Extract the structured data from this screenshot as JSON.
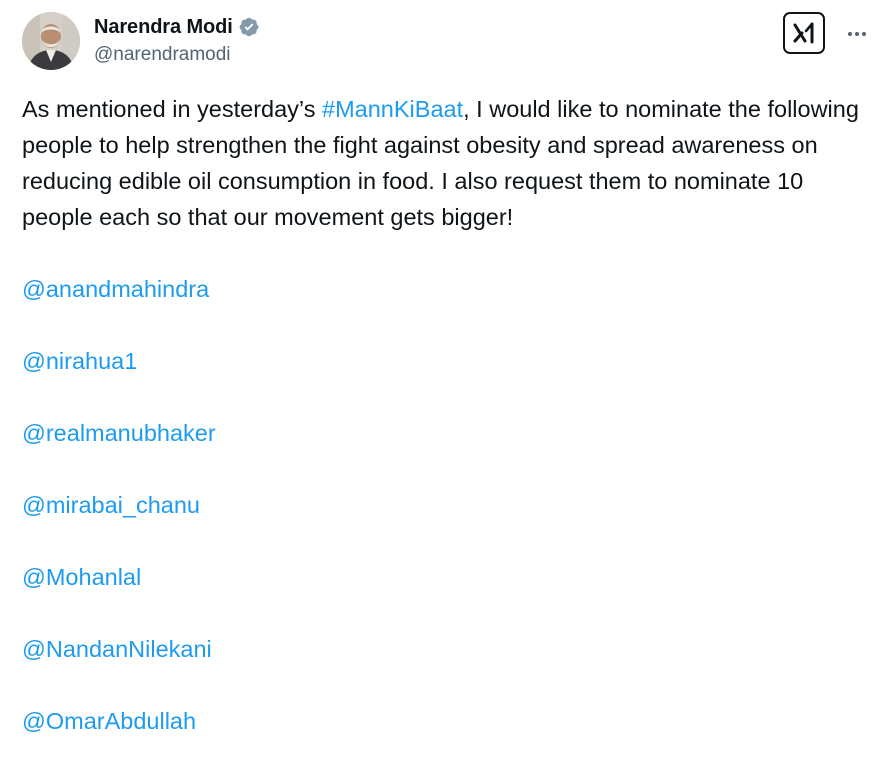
{
  "author": {
    "display_name": "Narendra Modi",
    "handle": "@narendramodi",
    "verified_badge": "verified-checkmark-icon",
    "verified_color": "#829aab"
  },
  "actions": {
    "grok_icon": "grok-logo-icon",
    "more_icon": "more-options-icon"
  },
  "post": {
    "text_before": "As mentioned in yesterday’s ",
    "hashtag": "#MannKiBaat",
    "text_after": ", I would like to nominate the following people to help strengthen the fight against obesity and spread awareness on reducing edible oil consumption in food. I also request them to nominate 10 people each so that our movement gets bigger!",
    "mentions": [
      "@anandmahindra",
      "@nirahua1",
      "@realmanubhaker",
      "@mirabai_chanu",
      "@Mohanlal",
      "@NandanNilekani",
      "@OmarAbdullah"
    ]
  },
  "colors": {
    "text": "#0f1419",
    "secondary_text": "#536471",
    "link": "#1d9bf0"
  }
}
